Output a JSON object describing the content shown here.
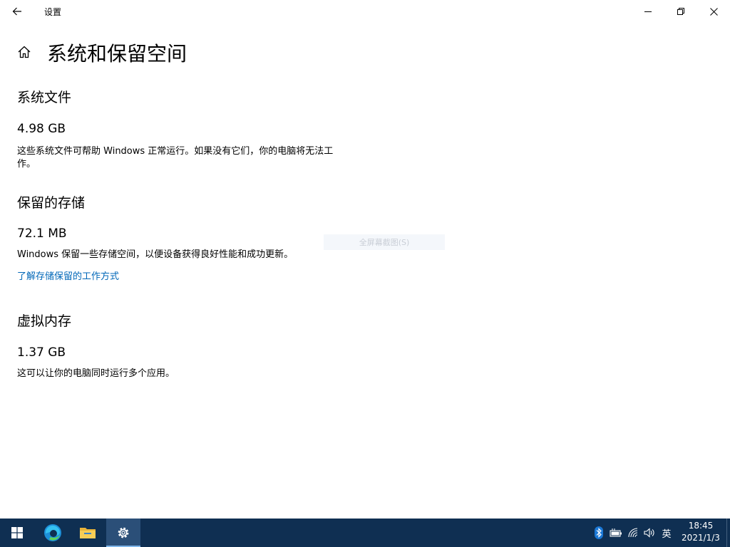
{
  "window": {
    "title": "设置"
  },
  "header": {
    "title": "系统和保留空间"
  },
  "sections": [
    {
      "heading": "系统文件",
      "size": "4.98 GB",
      "description": "这些系统文件可帮助 Windows 正常运行。如果没有它们，你的电脑将无法工作。"
    },
    {
      "heading": "保留的存储",
      "size": "72.1 MB",
      "description": "Windows 保留一些存储空间，以便设备获得良好性能和成功更新。",
      "link": "了解存储保留的工作方式"
    },
    {
      "heading": "虚拟内存",
      "size": "1.37 GB",
      "description": "这可以让你的电脑同时运行多个应用。"
    }
  ],
  "overlay_hint": "全屏幕截图(S)",
  "taskbar": {
    "ime": "英",
    "time": "18:45",
    "date": "2021/1/3"
  },
  "colors": {
    "accent": "#0067b8",
    "taskbar": "#0f2f52"
  }
}
